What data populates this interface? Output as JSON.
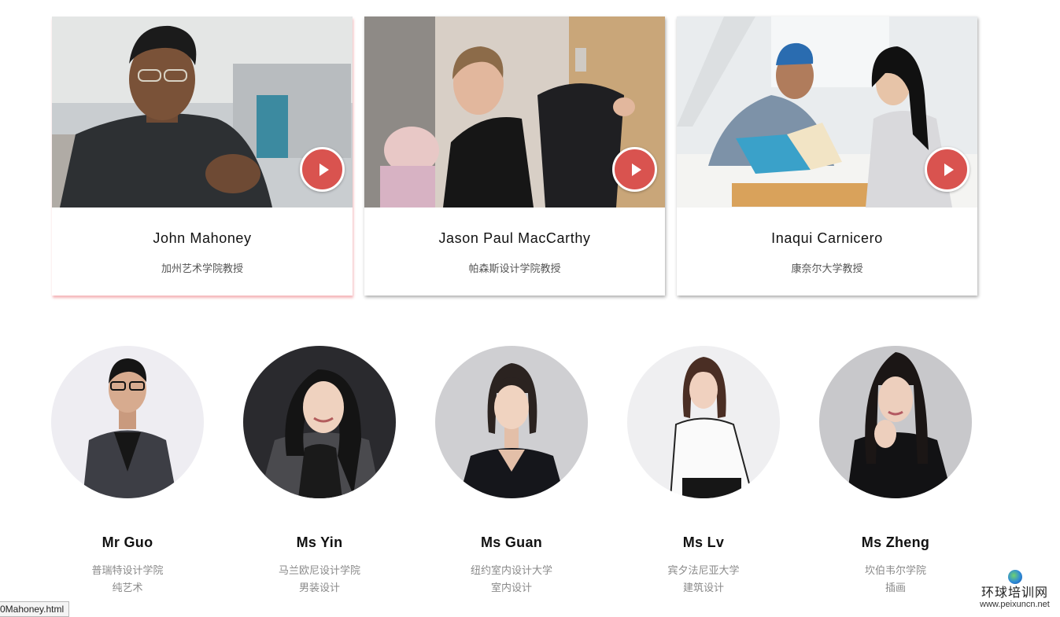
{
  "featured": [
    {
      "name": "John Mahoney",
      "title": "加州艺术学院教授",
      "play_icon": "play-icon"
    },
    {
      "name": "Jason Paul MacCarthy",
      "title": "帕森斯设计学院教授",
      "play_icon": "play-icon"
    },
    {
      "name": "Inaqui Carnicero",
      "title": "康奈尔大学教授",
      "play_icon": "play-icon"
    }
  ],
  "teachers": [
    {
      "name": "Mr Guo",
      "school": "普瑞特设计学院",
      "major": "纯艺术"
    },
    {
      "name": "Ms Yin",
      "school": "马兰欧尼设计学院",
      "major": "男装设计"
    },
    {
      "name": "Ms Guan",
      "school": "纽约室内设计大学",
      "major": "室内设计"
    },
    {
      "name": "Ms Lv",
      "school": "宾夕法尼亚大学",
      "major": "建筑设计"
    },
    {
      "name": "Ms Zheng",
      "school": "坎伯韦尔学院",
      "major": "插画"
    }
  ],
  "status_bar": {
    "url": "0Mahoney.html"
  },
  "watermark": {
    "cn": "环球培训网",
    "url": "www.peixuncn.net"
  },
  "colors": {
    "play_button": "#d9534f",
    "active_card_shadow": "#e65a64"
  }
}
